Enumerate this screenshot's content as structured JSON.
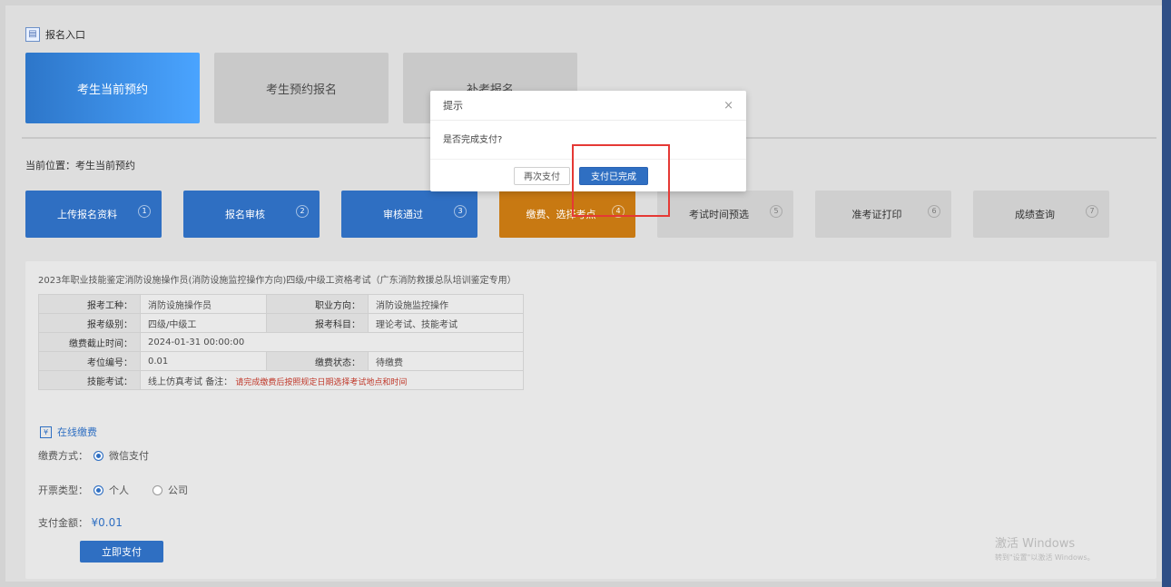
{
  "header": {
    "title": "报名入口",
    "icon": "entry-icon"
  },
  "cards": [
    {
      "label": "考生当前预约",
      "active": true
    },
    {
      "label": "考生预约报名",
      "active": false
    },
    {
      "label": "补考报名",
      "active": false
    }
  ],
  "location": {
    "label": "当前位置：考生当前预约"
  },
  "steps": [
    {
      "label": "上传报名资料",
      "num": "1"
    },
    {
      "label": "报名审核",
      "num": "2"
    },
    {
      "label": "审核通过",
      "num": "3"
    },
    {
      "label": "缴费、选择考点",
      "num": "4"
    },
    {
      "label": "考试时间预选",
      "num": "5"
    },
    {
      "label": "准考证打印",
      "num": "6"
    },
    {
      "label": "成绩查询",
      "num": "7"
    }
  ],
  "course_title": "2023年职业技能鉴定消防设施操作员(消防设施监控操作方向)四级/中级工资格考试（广东消防救援总队培训鉴定专用）",
  "info": {
    "labels": [
      "报考工种：",
      "职业方向：",
      "报考级别：",
      "报考科目：",
      "缴费截止时间：",
      "考位编号：",
      "缴费状态：",
      "技能考试："
    ],
    "values": {
      "kind": "消防设施操作员",
      "direction": "消防设施监控操作",
      "level": "四级/中级工",
      "subjects": "理论考试、技能考试",
      "deadline": "2024-01-31 00:00:00",
      "seat": "0.01",
      "status": "待缴费",
      "skill": "线上仿真考试",
      "note_label": "备注：",
      "note": "请完成缴费后按照规定日期选择考试地点和时间"
    }
  },
  "online_pay": {
    "label": "在线缴费"
  },
  "pay_method": {
    "label": "缴费方式：",
    "option": "微信支付"
  },
  "invoice": {
    "label": "开票类型：",
    "option1": "个人",
    "option2": "公司"
  },
  "amount": {
    "label": "支付金额：",
    "value": "¥0.01"
  },
  "confirm_button": "立即支付",
  "watermark": {
    "title": "激活 Windows",
    "sub": "转到\"设置\"以激活 Windows。"
  },
  "modal": {
    "title": "提示",
    "message": "是否完成支付?",
    "later": "再次支付",
    "done": "支付已完成"
  }
}
